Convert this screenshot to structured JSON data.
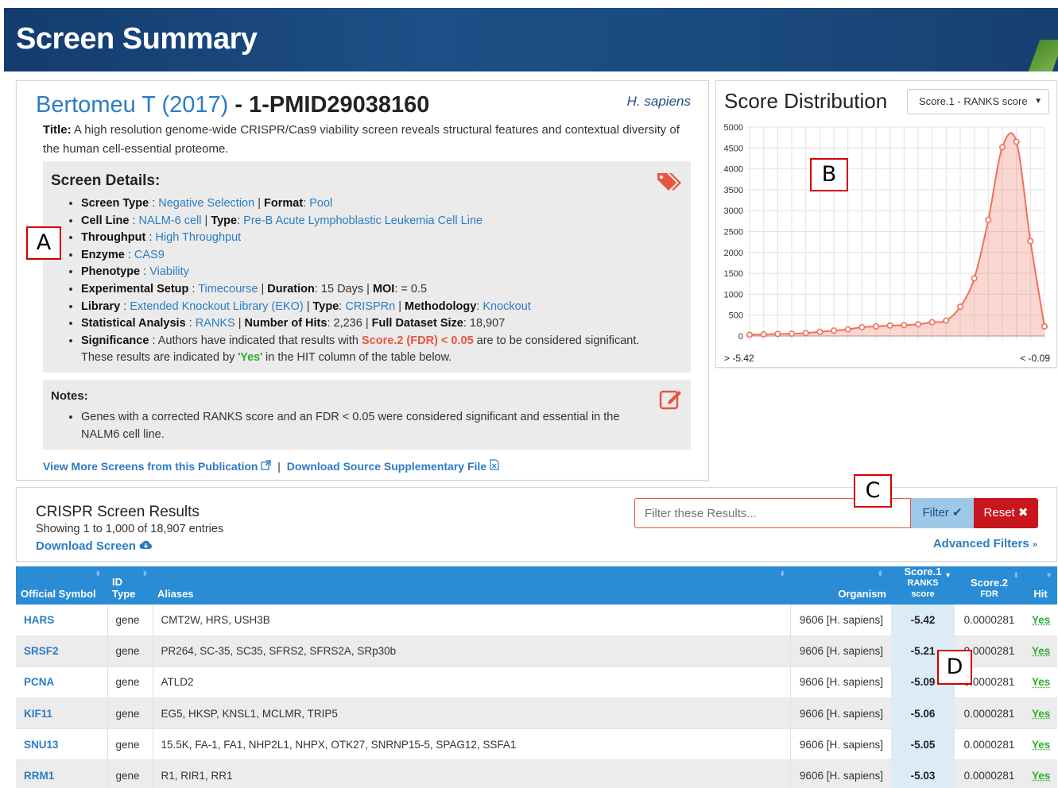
{
  "page": {
    "title": "Screen Summary"
  },
  "summary": {
    "author_link": "Bertomeu T (2017)",
    "dataset_id": " - 1-PMID29038160",
    "species": "H. sapiens",
    "title_label": "Title:",
    "title_text": " A high resolution genome-wide CRISPR/Cas9 viability screen reveals structural features and contextual diversity of the human cell-essential proteome.",
    "details_heading": "Screen Details:",
    "details": {
      "screen_type_label": "Screen Type",
      "screen_type": "Negative Selection",
      "format_label": "Format",
      "format": "Pool",
      "cell_line_label": "Cell Line",
      "cell_line": "NALM-6 cell",
      "type_label": "Type",
      "cell_type": "Pre-B Acute Lymphoblastic Leukemia Cell Line",
      "throughput_label": "Throughput",
      "throughput": "High Throughput",
      "enzyme_label": "Enzyme",
      "enzyme": "CAS9",
      "phenotype_label": "Phenotype",
      "phenotype": "Viability",
      "setup_label": "Experimental Setup",
      "setup": "Timecourse",
      "duration_label": "Duration",
      "duration": " 15 Days",
      "moi_label": "MOI",
      "moi": " = 0.5",
      "library_label": "Library",
      "library": "Extended Knockout Library (EKO)",
      "library_type": "CRISPRn",
      "methodology_label": "Methodology",
      "methodology": "Knockout",
      "stat_label": "Statistical Analysis",
      "stat": "RANKS",
      "hits_label": "Number of Hits",
      "hits": " 2,236",
      "size_label": "Full Dataset Size",
      "size": " 18,907",
      "sig_label": "Significance",
      "sig_pre": " : Authors have indicated that results with ",
      "sig_rule": "Score.2 (FDR) < 0.05",
      "sig_post": " are to be considered significant.",
      "sig_line2_pre": "These results are indicated by '",
      "sig_yes": "Yes",
      "sig_line2_post": "' in the HIT column of the table below."
    },
    "notes_heading": "Notes:",
    "notes_text": "Genes with a corrected RANKS score and an FDR < 0.05 were considered significant and essential in the NALM6 cell line.",
    "link_more": "View More Screens from this Publication",
    "link_download": "Download Source Supplementary File",
    "colors": {
      "link": "#2c7cc4",
      "significant": "#e8553d",
      "yes": "#2db02d"
    }
  },
  "distribution": {
    "title": "Score Distribution",
    "select_value": "Score.1 - RANKS score",
    "x_left_label": "> -5.42",
    "x_right_label": "< -0.09"
  },
  "chart_data": {
    "type": "area",
    "title": "Score Distribution",
    "xlabel": "",
    "ylabel": "",
    "ylim": [
      0,
      5000
    ],
    "yticks": [
      0,
      500,
      1000,
      1500,
      2000,
      2500,
      3000,
      3500,
      4000,
      4500,
      5000
    ],
    "x_range_labels": [
      "> -5.42",
      "< -0.09"
    ],
    "series": [
      {
        "values": [
          30,
          40,
          50,
          55,
          70,
          100,
          130,
          160,
          210,
          230,
          250,
          260,
          280,
          330,
          370,
          700,
          1380,
          2780,
          4520,
          4650,
          2270,
          230
        ],
        "color": "#f0705a"
      }
    ],
    "grid": true
  },
  "results_header": {
    "title": "CRISPR Screen Results",
    "count": "Showing 1 to 1,000 of 18,907 entries",
    "download": "Download Screen",
    "filter_placeholder": "Filter these Results...",
    "filter_button": "Filter",
    "reset_button": "Reset",
    "advanced": "Advanced Filters"
  },
  "table": {
    "columns": {
      "symbol": "Official Symbol",
      "idtype": "ID Type",
      "aliases": "Aliases",
      "organism": "Organism",
      "score1": "Score.1",
      "score1_sub": "RANKS score",
      "score2": "Score.2",
      "score2_sub": "FDR",
      "hit": "Hit"
    },
    "rows": [
      {
        "symbol": "HARS",
        "idtype": "gene",
        "aliases": "CMT2W, HRS, USH3B",
        "organism": "9606 [H. sapiens]",
        "score1": "-5.42",
        "score2": "0.0000281",
        "hit": "Yes"
      },
      {
        "symbol": "SRSF2",
        "idtype": "gene",
        "aliases": "PR264, SC-35, SC35, SFRS2, SFRS2A, SRp30b",
        "organism": "9606 [H. sapiens]",
        "score1": "-5.21",
        "score2": "0.0000281",
        "hit": "Yes"
      },
      {
        "symbol": "PCNA",
        "idtype": "gene",
        "aliases": "ATLD2",
        "organism": "9606 [H. sapiens]",
        "score1": "-5.09",
        "score2": "0.0000281",
        "hit": "Yes"
      },
      {
        "symbol": "KIF11",
        "idtype": "gene",
        "aliases": "EG5, HKSP, KNSL1, MCLMR, TRIP5",
        "organism": "9606 [H. sapiens]",
        "score1": "-5.06",
        "score2": "0.0000281",
        "hit": "Yes"
      },
      {
        "symbol": "SNU13",
        "idtype": "gene",
        "aliases": "15.5K, FA-1, FA1, NHP2L1, NHPX, OTK27, SNRNP15-5, SPAG12, SSFA1",
        "organism": "9606 [H. sapiens]",
        "score1": "-5.05",
        "score2": "0.0000281",
        "hit": "Yes"
      },
      {
        "symbol": "RRM1",
        "idtype": "gene",
        "aliases": "R1, RIR1, RR1",
        "organism": "9606 [H. sapiens]",
        "score1": "-5.03",
        "score2": "0.0000281",
        "hit": "Yes"
      }
    ]
  },
  "callouts": {
    "a": "A",
    "b": "B",
    "c": "C",
    "d": "D"
  }
}
